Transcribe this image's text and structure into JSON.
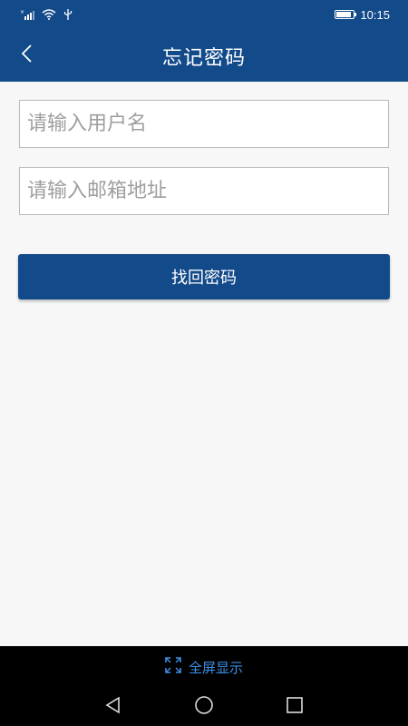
{
  "status_bar": {
    "time": "10:15",
    "icons": [
      "signal-icon",
      "wifi-icon",
      "usb-icon",
      "battery-icon"
    ],
    "battery_level": 0.85
  },
  "header": {
    "title": "忘记密码",
    "back_icon": "chevron-left-icon"
  },
  "form": {
    "username_placeholder": "请输入用户名",
    "username_value": "",
    "email_placeholder": "请输入邮箱地址",
    "email_value": "",
    "submit_label": "找回密码"
  },
  "bottom": {
    "fullscreen_label": "全屏显示",
    "fullscreen_icon": "expand-icon",
    "nav_icons": [
      "back-triangle-icon",
      "home-circle-icon",
      "recents-square-icon"
    ]
  },
  "colors": {
    "primary": "#134a8a",
    "page_bg": "#f7f7f7",
    "link_blue": "#3d8fe6"
  }
}
